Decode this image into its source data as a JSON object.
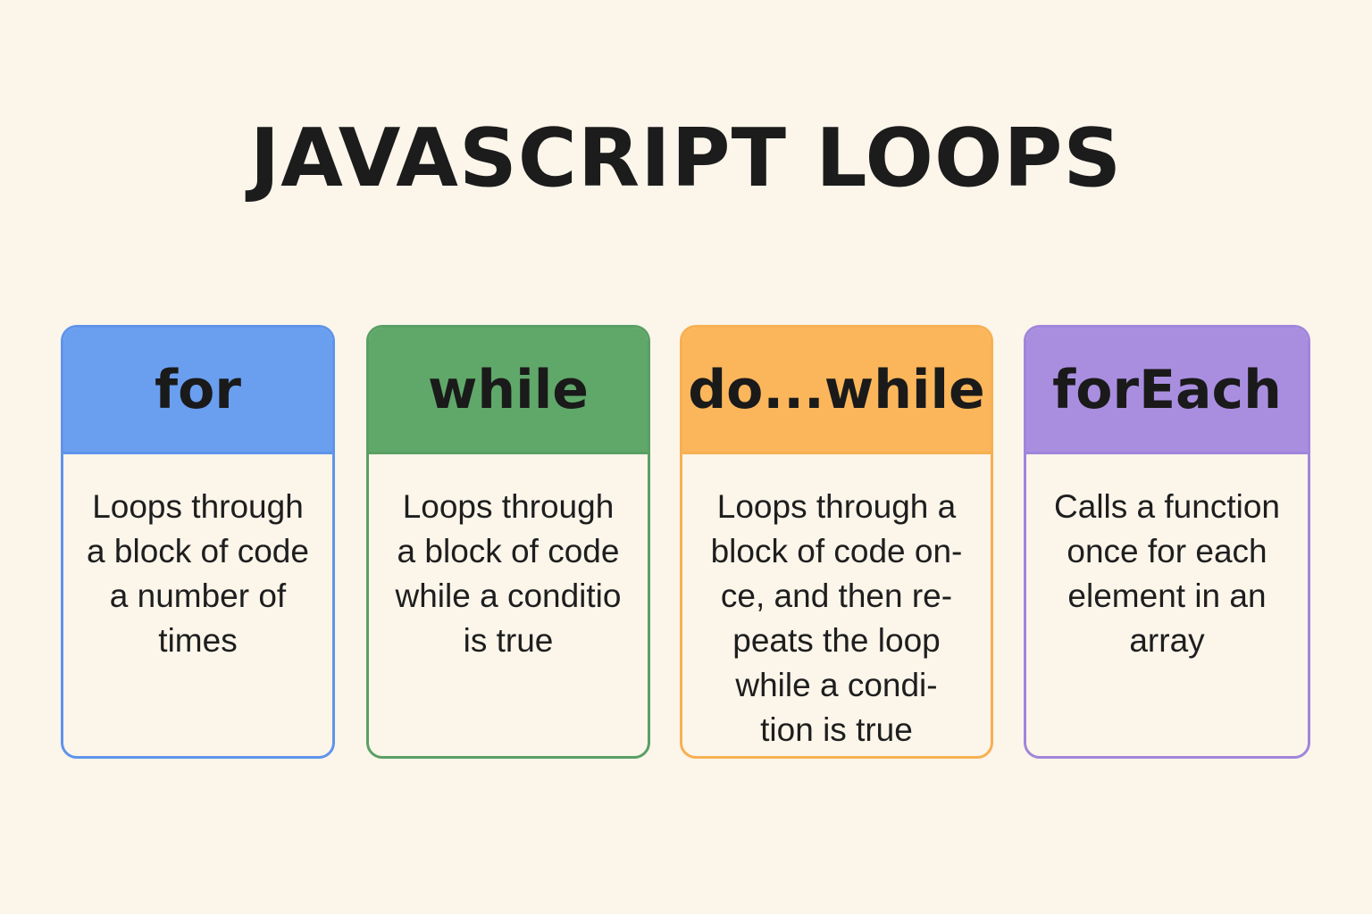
{
  "title": "JAVASCRIPT LOOPS",
  "colors": {
    "background": "#fbf5ea",
    "text": "#1a1a1a"
  },
  "cards": [
    {
      "name": "for",
      "description": "Loops through\na block of code\na number of\ntimes",
      "header_color": "#6a9ff0",
      "border_color": "#5f94ea"
    },
    {
      "name": "while",
      "description": "Loops through\na block of code\nwhile a conditio\nis true",
      "header_color": "#60a86a",
      "border_color": "#5a9f64"
    },
    {
      "name": "do...while",
      "description": "Loops through a\nblock of code on-\nce, and then re-\npeats the loop\nwhile a condi-\ntion is true",
      "header_color": "#fbb65b",
      "border_color": "#f7b052"
    },
    {
      "name": "forEach",
      "description": "Calls a function\nonce for each\nelement in an\narray",
      "header_color": "#a98ee0",
      "border_color": "#a185da"
    }
  ]
}
